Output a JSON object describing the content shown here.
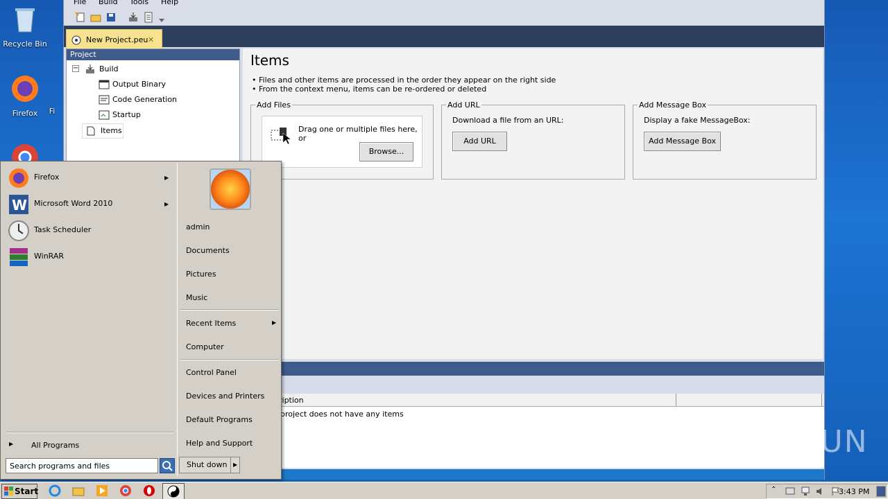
{
  "desktop": {
    "icons": [
      {
        "label": "Recycle Bin"
      },
      {
        "label": "Firefox"
      },
      {
        "label": "Fi"
      }
    ]
  },
  "app": {
    "menu": [
      "File",
      "Build",
      "Tools",
      "Help"
    ],
    "doc_tab": {
      "label": "New Project.peu",
      "close": "✕"
    },
    "project_header": "Project",
    "tree": {
      "build": "Build",
      "output_binary": "Output Binary",
      "code_generation": "Code Generation",
      "startup": "Startup",
      "items": "Items"
    },
    "items_page": {
      "title": "Items",
      "notes": [
        "• Files and other items are processed in the order they appear on the right side",
        "• From the context menu, items can be re-ordered or deleted"
      ],
      "add_files": {
        "legend": "Add Files",
        "text": "Drag one or multiple files here, or",
        "button": "Browse..."
      },
      "add_url": {
        "legend": "Add URL",
        "text": "Download a file from an URL:",
        "button": "Add URL"
      },
      "add_message_box": {
        "legend": "Add Message Box",
        "text": "Display a fake MessageBox:",
        "button": "Add Message Box"
      }
    },
    "list": {
      "column_description": "ription",
      "empty_message": "project does not have any items"
    }
  },
  "start_menu": {
    "programs": [
      {
        "label": "Firefox",
        "has_submenu": true
      },
      {
        "label": "Microsoft Word 2010",
        "has_submenu": true
      },
      {
        "label": "Task Scheduler",
        "has_submenu": false
      },
      {
        "label": "WinRAR",
        "has_submenu": false
      }
    ],
    "all_programs": "All Programs",
    "search_placeholder": "Search programs and files",
    "shutdown": "Shut down",
    "right": {
      "user": "admin",
      "documents": "Documents",
      "pictures": "Pictures",
      "music": "Music",
      "recent_items": "Recent Items",
      "computer": "Computer",
      "control_panel": "Control Panel",
      "devices_printers": "Devices and Printers",
      "default_programs": "Default Programs",
      "help_support": "Help and Support"
    }
  },
  "taskbar": {
    "start": "Start",
    "clock": "3:43 PM"
  },
  "watermark": "ANY RUN",
  "colors": {
    "desktop": "#1d74d3",
    "title_bar": "#2e3f5e",
    "tab_active": "#f7e28f",
    "pane_header": "#3e5b8c",
    "start_menu_bg": "#d4d0c8"
  }
}
